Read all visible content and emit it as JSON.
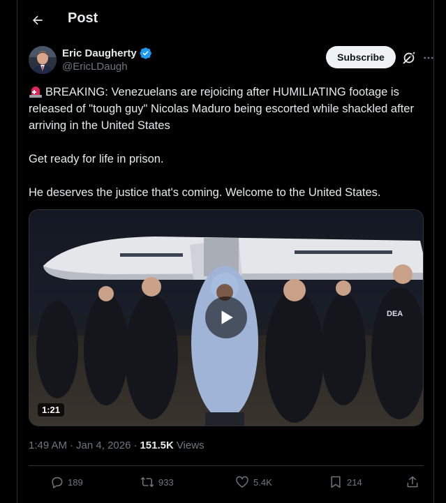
{
  "header": {
    "title": "Post"
  },
  "author": {
    "name": "Eric Daugherty",
    "handle": "@EricLDaugh",
    "verified": true
  },
  "subscribe_label": "Subscribe",
  "post": {
    "paragraph1": "BREAKING: Venezuelans are rejoicing after HUMILIATING footage is released of \"tough guy\" Nicolas Maduro being escorted while shackled after arriving in the United States",
    "paragraph2": "Get ready for life in prison.",
    "paragraph3": "He deserves the justice that's coming. Welcome to the United States."
  },
  "media": {
    "duration": "1:21",
    "plane_tail_label": "DEA"
  },
  "meta": {
    "time": "1:49 AM",
    "separator": "·",
    "date": "Jan 4, 2026",
    "views_count": "151.5K",
    "views_label": "Views"
  },
  "actions": {
    "replies": "189",
    "reposts": "933",
    "likes": "5.4K",
    "bookmarks": "214"
  },
  "colors": {
    "background": "#000000",
    "text": "#e7e9ea",
    "muted": "#71767b",
    "verified": "#1d9bf0",
    "border": "#2f3336"
  }
}
